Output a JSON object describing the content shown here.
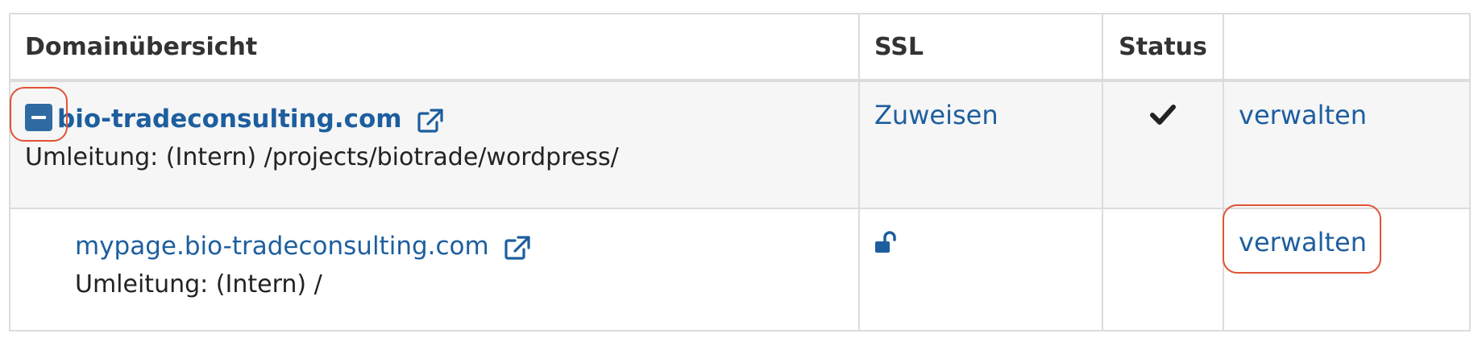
{
  "table": {
    "headers": [
      "Domainübersicht",
      "SSL",
      "Status",
      ""
    ],
    "rows": [
      {
        "domain": "bio-tradeconsulting.com",
        "redirect": "Umleitung: (Intern) /projects/biotrade/wordpress/",
        "ssl_label": "Zuweisen",
        "status_icon": "checkmark-icon",
        "action_label": "verwalten",
        "expanded": true,
        "toggle_icon": "collapse-minus-icon"
      },
      {
        "domain": "mypage.bio-tradeconsulting.com",
        "redirect": "Umleitung: (Intern) /",
        "ssl_icon": "unlock-icon",
        "action_label": "verwalten"
      }
    ]
  },
  "colors": {
    "link": "#1d5e9e",
    "toggle": "#2f6aa3",
    "highlight": "#e05335",
    "row_alt": "#f6f6f6",
    "border": "#dcdcdc"
  }
}
